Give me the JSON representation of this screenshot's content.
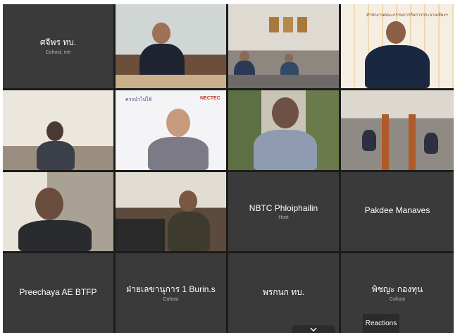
{
  "tiles": [
    {
      "name": "ศจีพร ทบ.",
      "role": "Cohost, me"
    },
    {
      "name": "NBTC Phloiphailin",
      "role": "Host"
    },
    {
      "name": "Pakdee Manaves",
      "role": ""
    },
    {
      "name": "Preechaya AE BTFP",
      "role": ""
    },
    {
      "name": "ฝ่ายเลขานุการ 1 Burin.s",
      "role": "Cohost"
    },
    {
      "name": "พรกนก ทบ.",
      "role": ""
    },
    {
      "name": "พิชญะ กองทุน",
      "role": "Cohost"
    }
  ],
  "backdrop_text": {
    "banner": "สำนักงานคณะกรรมการกิจการกระจายเสียงฯ",
    "logo_left": "ควรนำไปใช้",
    "logo_right": "NECTEC"
  },
  "controls": {
    "reactions_label": "Reactions",
    "more_icon": "chevron-down-icon"
  },
  "colors": {
    "tile_bg": "#3a3a3a",
    "grid_bg": "#1c1c1c",
    "page_bg": "#ffffff"
  }
}
